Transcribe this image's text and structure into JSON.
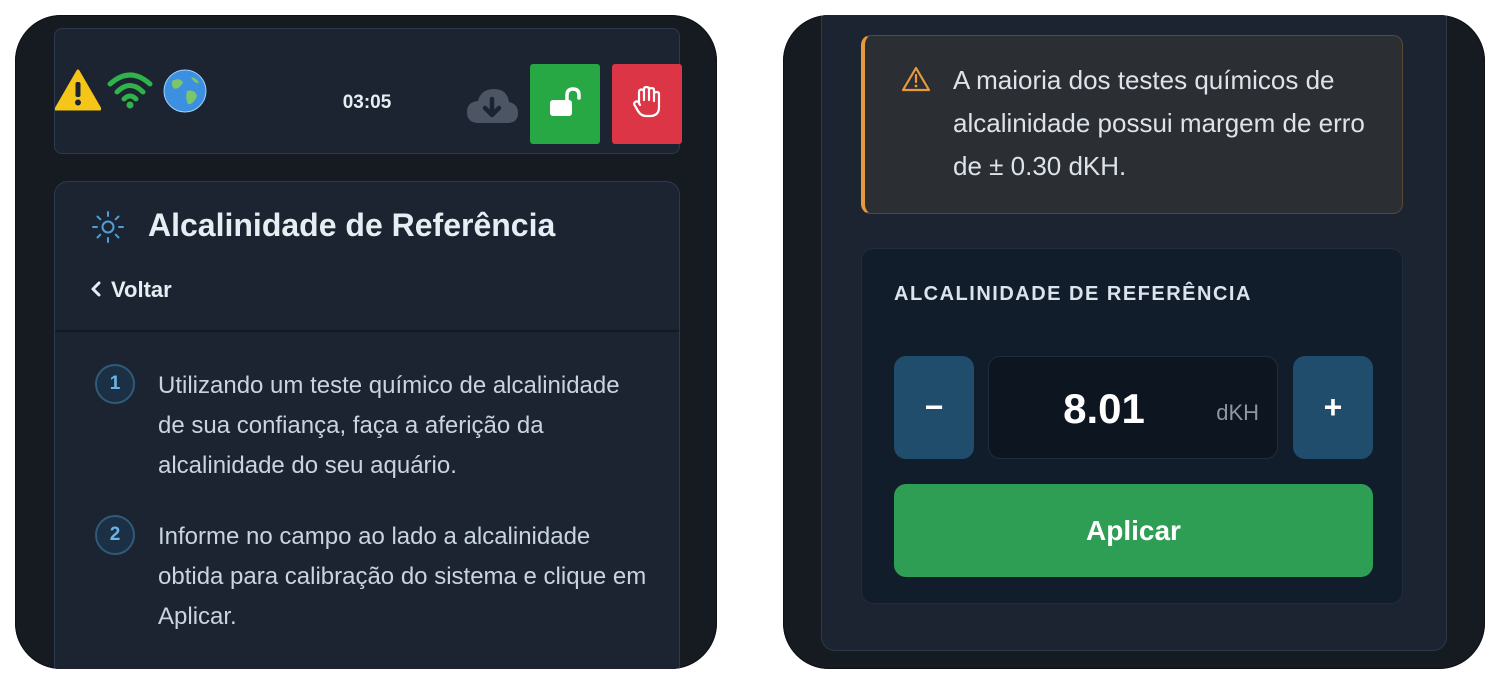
{
  "status_bar": {
    "time": "03:05",
    "icons": [
      "warning-icon",
      "wifi-icon",
      "globe-icon",
      "cloud-download-icon",
      "unlock-icon",
      "hand-stop-icon"
    ],
    "colors": {
      "warning": "#f5c518",
      "wifi": "#2fb34a",
      "unlock": "#28a745",
      "stop": "#dc3545"
    }
  },
  "page": {
    "title": "Alcalinidade de Referência",
    "back_label": "Voltar",
    "steps": [
      {
        "number": "1",
        "text": "Utilizando um teste químico de alcalinidade de sua confiança, faça a aferição da alcalinidade do seu aquário."
      },
      {
        "number": "2",
        "text": "Informe no campo ao lado a alcalinidade obtida para calibração do sistema e clique em Aplicar."
      }
    ]
  },
  "alert": {
    "text": "A maioria dos testes químicos de alcalinidade possui margem de erro de ± 0.30 dKH."
  },
  "reference": {
    "title": "ALCALINIDADE DE REFERÊNCIA",
    "minus_label": "−",
    "plus_label": "+",
    "value": "8.01",
    "unit": "dKH",
    "apply_label": "Aplicar"
  }
}
